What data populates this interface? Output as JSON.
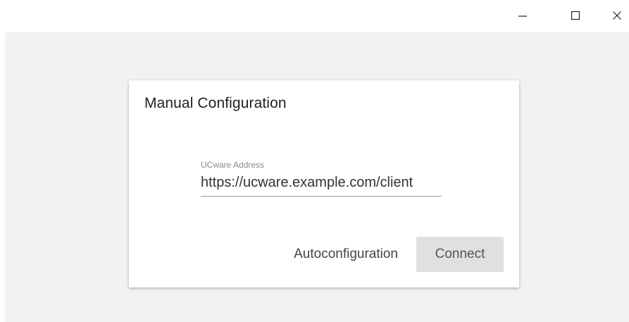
{
  "window": {
    "controls": {
      "minimize_icon": "minimize-icon",
      "maximize_icon": "maximize-icon",
      "close_icon": "close-icon"
    }
  },
  "dialog": {
    "title": "Manual Configuration",
    "address_field": {
      "label": "UCware Address",
      "value": "https://ucware.example.com/client"
    },
    "autoconfig_label": "Autoconfiguration",
    "connect_label": "Connect"
  },
  "colors": {
    "background": "#f2f2f2",
    "card": "#ffffff",
    "button_disabled": "#e0e0e0"
  }
}
